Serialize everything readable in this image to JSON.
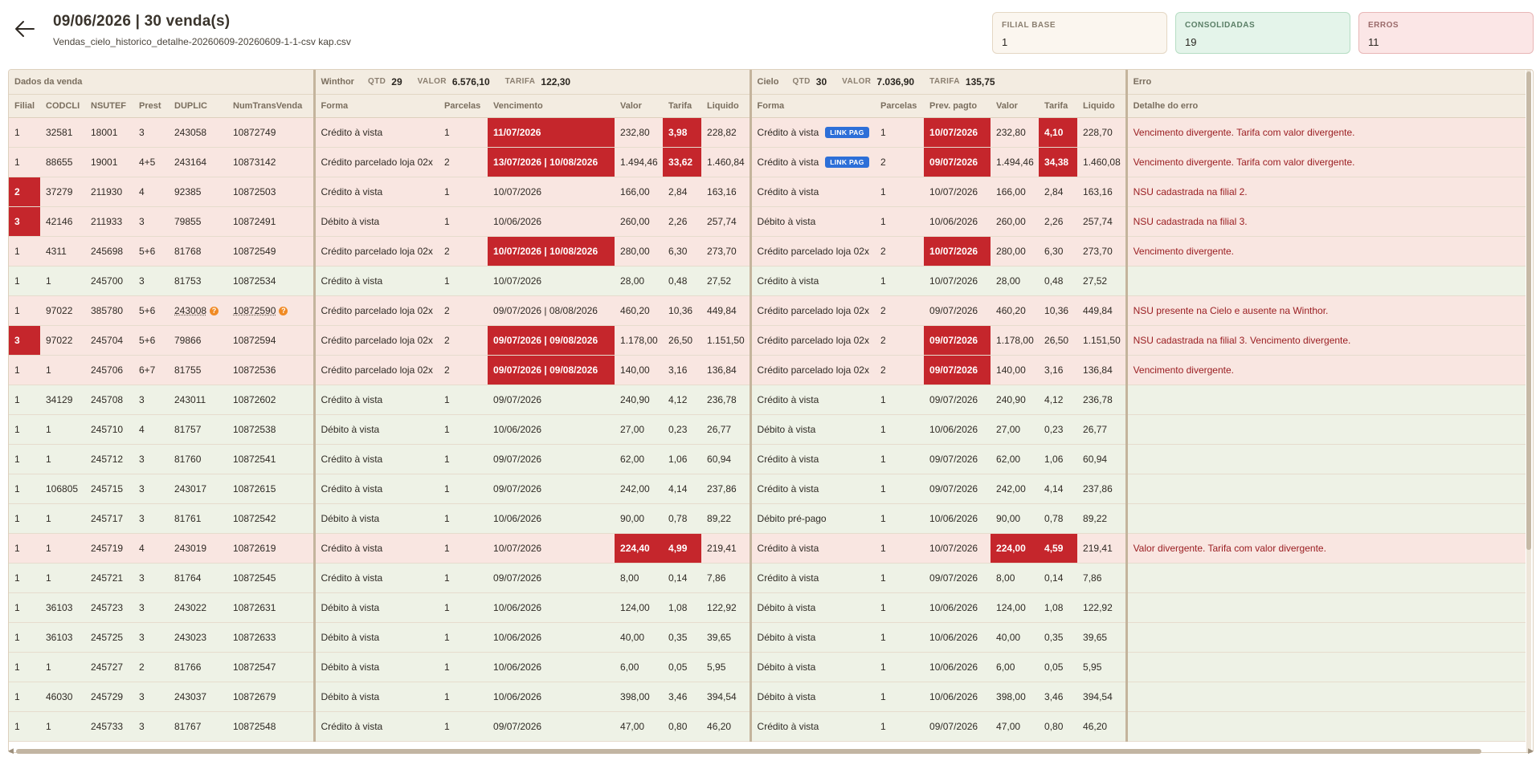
{
  "header": {
    "title": "09/06/2026 | 30 venda(s)",
    "filename": "Vendas_cielo_historico_detalhe-20260609-20260609-1-1-csv kap.csv"
  },
  "stats": {
    "base": {
      "label": "FILIAL BASE",
      "value": "1"
    },
    "consolidadas": {
      "label": "CONSOLIDADAS",
      "value": "19"
    },
    "erros": {
      "label": "ERROS",
      "value": "11"
    }
  },
  "groups": {
    "dados": {
      "name": "Dados da venda"
    },
    "winthor": {
      "name": "Winthor",
      "qtd_label": "QTD",
      "qtd": "29",
      "valor_label": "VALOR",
      "valor": "6.576,10",
      "tarifa_label": "TARIFA",
      "tarifa": "122,30"
    },
    "cielo": {
      "name": "Cielo",
      "qtd_label": "QTD",
      "qtd": "30",
      "valor_label": "VALOR",
      "valor": "7.036,90",
      "tarifa_label": "TARIFA",
      "tarifa": "135,75"
    },
    "erro": {
      "name": "Erro"
    }
  },
  "columns": [
    "Filial",
    "CODCLI",
    "NSUTEF",
    "Prest",
    "DUPLIC",
    "NumTransVenda",
    "Forma",
    "Parcelas",
    "Vencimento",
    "Valor",
    "Tarifa",
    "Liquido",
    "Forma",
    "Parcelas",
    "Prev. pagto",
    "Valor",
    "Tarifa",
    "Liquido",
    "Detalhe do erro"
  ],
  "badge_label": "LINK PAG",
  "help_icon": "question-mark-icon",
  "colors": {
    "error_red": "#c5262c",
    "ok_row": "#eef2e6",
    "bad_row": "#f9e6e1",
    "badge_blue": "#2d6fd8",
    "help_orange": "#f08a24"
  },
  "rows": [
    {
      "status": "bad",
      "filial": "1",
      "codcli": "32581",
      "nsutef": "18001",
      "prest": "3",
      "duplic": "243058",
      "numtrans": "10872749",
      "w_forma": "Crédito à vista",
      "w_parc": "1",
      "w_venc": "11/07/2026",
      "w_valor": "232,80",
      "w_tarifa": "3,98",
      "w_liq": "228,82",
      "c_forma": "Crédito à vista",
      "c_link": true,
      "c_parc": "1",
      "c_prev": "10/07/2026",
      "c_valor": "232,80",
      "c_tarifa": "4,10",
      "c_liq": "228,70",
      "erro": "Vencimento divergente. Tarifa com valor divergente.",
      "hl": [
        "w_venc",
        "w_tarifa",
        "c_prev",
        "c_tarifa"
      ]
    },
    {
      "status": "bad",
      "filial": "1",
      "codcli": "88655",
      "nsutef": "19001",
      "prest": "4+5",
      "duplic": "243164",
      "numtrans": "10873142",
      "w_forma": "Crédito parcelado loja 02x",
      "w_parc": "2",
      "w_venc": "13/07/2026 | 10/08/2026",
      "w_valor": "1.494,46",
      "w_tarifa": "33,62",
      "w_liq": "1.460,84",
      "c_forma": "Crédito à vista",
      "c_link": true,
      "c_parc": "2",
      "c_prev": "09/07/2026",
      "c_valor": "1.494,46",
      "c_tarifa": "34,38",
      "c_liq": "1.460,08",
      "erro": "Vencimento divergente. Tarifa com valor divergente.",
      "hl": [
        "w_venc",
        "w_tarifa",
        "c_prev",
        "c_tarifa"
      ]
    },
    {
      "status": "bad",
      "filial": "2",
      "codcli": "37279",
      "nsutef": "211930",
      "prest": "4",
      "duplic": "92385",
      "numtrans": "10872503",
      "w_forma": "Crédito à vista",
      "w_parc": "1",
      "w_venc": "10/07/2026",
      "w_valor": "166,00",
      "w_tarifa": "2,84",
      "w_liq": "163,16",
      "c_forma": "Crédito à vista",
      "c_parc": "1",
      "c_prev": "10/07/2026",
      "c_valor": "166,00",
      "c_tarifa": "2,84",
      "c_liq": "163,16",
      "erro": "NSU cadastrada na filial 2.",
      "hl": [
        "filial"
      ]
    },
    {
      "status": "bad",
      "filial": "3",
      "codcli": "42146",
      "nsutef": "211933",
      "prest": "3",
      "duplic": "79855",
      "numtrans": "10872491",
      "w_forma": "Débito à vista",
      "w_parc": "1",
      "w_venc": "10/06/2026",
      "w_valor": "260,00",
      "w_tarifa": "2,26",
      "w_liq": "257,74",
      "c_forma": "Débito à vista",
      "c_parc": "1",
      "c_prev": "10/06/2026",
      "c_valor": "260,00",
      "c_tarifa": "2,26",
      "c_liq": "257,74",
      "erro": "NSU cadastrada na filial 3.",
      "hl": [
        "filial"
      ]
    },
    {
      "status": "bad",
      "filial": "1",
      "codcli": "4311",
      "nsutef": "245698",
      "prest": "5+6",
      "duplic": "81768",
      "numtrans": "10872549",
      "w_forma": "Crédito parcelado loja 02x",
      "w_parc": "2",
      "w_venc": "10/07/2026 | 10/08/2026",
      "w_valor": "280,00",
      "w_tarifa": "6,30",
      "w_liq": "273,70",
      "c_forma": "Crédito parcelado loja 02x",
      "c_parc": "2",
      "c_prev": "10/07/2026",
      "c_valor": "280,00",
      "c_tarifa": "6,30",
      "c_liq": "273,70",
      "erro": "Vencimento divergente.",
      "hl": [
        "w_venc",
        "c_prev"
      ]
    },
    {
      "status": "ok",
      "filial": "1",
      "codcli": "1",
      "nsutef": "245700",
      "prest": "3",
      "duplic": "81753",
      "numtrans": "10872534",
      "w_forma": "Crédito à vista",
      "w_parc": "1",
      "w_venc": "10/07/2026",
      "w_valor": "28,00",
      "w_tarifa": "0,48",
      "w_liq": "27,52",
      "c_forma": "Crédito à vista",
      "c_parc": "1",
      "c_prev": "10/07/2026",
      "c_valor": "28,00",
      "c_tarifa": "0,48",
      "c_liq": "27,52",
      "erro": "",
      "hl": []
    },
    {
      "status": "bad",
      "filial": "1",
      "codcli": "97022",
      "nsutef": "385780",
      "prest": "5+6",
      "duplic": "243008",
      "numtrans": "10872590",
      "dup_help": true,
      "w_forma": "Crédito parcelado loja 02x",
      "w_parc": "2",
      "w_venc": "09/07/2026 | 08/08/2026",
      "w_valor": "460,20",
      "w_tarifa": "10,36",
      "w_liq": "449,84",
      "c_forma": "Crédito parcelado loja 02x",
      "c_parc": "2",
      "c_prev": "09/07/2026",
      "c_valor": "460,20",
      "c_tarifa": "10,36",
      "c_liq": "449,84",
      "erro": "NSU presente na Cielo e ausente na Winthor.",
      "hl": []
    },
    {
      "status": "bad",
      "filial": "3",
      "codcli": "97022",
      "nsutef": "245704",
      "prest": "5+6",
      "duplic": "79866",
      "numtrans": "10872594",
      "w_forma": "Crédito parcelado loja 02x",
      "w_parc": "2",
      "w_venc": "09/07/2026 | 09/08/2026",
      "w_valor": "1.178,00",
      "w_tarifa": "26,50",
      "w_liq": "1.151,50",
      "c_forma": "Crédito parcelado loja 02x",
      "c_parc": "2",
      "c_prev": "09/07/2026",
      "c_valor": "1.178,00",
      "c_tarifa": "26,50",
      "c_liq": "1.151,50",
      "erro": "NSU cadastrada na filial 3. Vencimento divergente.",
      "hl": [
        "filial",
        "w_venc",
        "c_prev"
      ]
    },
    {
      "status": "bad",
      "filial": "1",
      "codcli": "1",
      "nsutef": "245706",
      "prest": "6+7",
      "duplic": "81755",
      "numtrans": "10872536",
      "w_forma": "Crédito parcelado loja 02x",
      "w_parc": "2",
      "w_venc": "09/07/2026 | 09/08/2026",
      "w_valor": "140,00",
      "w_tarifa": "3,16",
      "w_liq": "136,84",
      "c_forma": "Crédito parcelado loja 02x",
      "c_parc": "2",
      "c_prev": "09/07/2026",
      "c_valor": "140,00",
      "c_tarifa": "3,16",
      "c_liq": "136,84",
      "erro": "Vencimento divergente.",
      "hl": [
        "w_venc",
        "c_prev"
      ]
    },
    {
      "status": "ok",
      "filial": "1",
      "codcli": "34129",
      "nsutef": "245708",
      "prest": "3",
      "duplic": "243011",
      "numtrans": "10872602",
      "w_forma": "Crédito à vista",
      "w_parc": "1",
      "w_venc": "09/07/2026",
      "w_valor": "240,90",
      "w_tarifa": "4,12",
      "w_liq": "236,78",
      "c_forma": "Crédito à vista",
      "c_parc": "1",
      "c_prev": "09/07/2026",
      "c_valor": "240,90",
      "c_tarifa": "4,12",
      "c_liq": "236,78",
      "erro": "",
      "hl": []
    },
    {
      "status": "ok",
      "filial": "1",
      "codcli": "1",
      "nsutef": "245710",
      "prest": "4",
      "duplic": "81757",
      "numtrans": "10872538",
      "w_forma": "Débito à vista",
      "w_parc": "1",
      "w_venc": "10/06/2026",
      "w_valor": "27,00",
      "w_tarifa": "0,23",
      "w_liq": "26,77",
      "c_forma": "Débito à vista",
      "c_parc": "1",
      "c_prev": "10/06/2026",
      "c_valor": "27,00",
      "c_tarifa": "0,23",
      "c_liq": "26,77",
      "erro": "",
      "hl": []
    },
    {
      "status": "ok",
      "filial": "1",
      "codcli": "1",
      "nsutef": "245712",
      "prest": "3",
      "duplic": "81760",
      "numtrans": "10872541",
      "w_forma": "Crédito à vista",
      "w_parc": "1",
      "w_venc": "09/07/2026",
      "w_valor": "62,00",
      "w_tarifa": "1,06",
      "w_liq": "60,94",
      "c_forma": "Crédito à vista",
      "c_parc": "1",
      "c_prev": "09/07/2026",
      "c_valor": "62,00",
      "c_tarifa": "1,06",
      "c_liq": "60,94",
      "erro": "",
      "hl": []
    },
    {
      "status": "ok",
      "filial": "1",
      "codcli": "106805",
      "nsutef": "245715",
      "prest": "3",
      "duplic": "243017",
      "numtrans": "10872615",
      "w_forma": "Crédito à vista",
      "w_parc": "1",
      "w_venc": "09/07/2026",
      "w_valor": "242,00",
      "w_tarifa": "4,14",
      "w_liq": "237,86",
      "c_forma": "Crédito à vista",
      "c_parc": "1",
      "c_prev": "09/07/2026",
      "c_valor": "242,00",
      "c_tarifa": "4,14",
      "c_liq": "237,86",
      "erro": "",
      "hl": []
    },
    {
      "status": "ok",
      "filial": "1",
      "codcli": "1",
      "nsutef": "245717",
      "prest": "3",
      "duplic": "81761",
      "numtrans": "10872542",
      "w_forma": "Débito à vista",
      "w_parc": "1",
      "w_venc": "10/06/2026",
      "w_valor": "90,00",
      "w_tarifa": "0,78",
      "w_liq": "89,22",
      "c_forma": "Débito pré-pago",
      "c_parc": "1",
      "c_prev": "10/06/2026",
      "c_valor": "90,00",
      "c_tarifa": "0,78",
      "c_liq": "89,22",
      "erro": "",
      "hl": []
    },
    {
      "status": "bad",
      "filial": "1",
      "codcli": "1",
      "nsutef": "245719",
      "prest": "4",
      "duplic": "243019",
      "numtrans": "10872619",
      "w_forma": "Crédito à vista",
      "w_parc": "1",
      "w_venc": "10/07/2026",
      "w_valor": "224,40",
      "w_tarifa": "4,99",
      "w_liq": "219,41",
      "c_forma": "Crédito à vista",
      "c_parc": "1",
      "c_prev": "10/07/2026",
      "c_valor": "224,00",
      "c_tarifa": "4,59",
      "c_liq": "219,41",
      "erro": "Valor divergente. Tarifa com valor divergente.",
      "hl": [
        "w_valor",
        "w_tarifa",
        "c_valor",
        "c_tarifa"
      ]
    },
    {
      "status": "ok",
      "filial": "1",
      "codcli": "1",
      "nsutef": "245721",
      "prest": "3",
      "duplic": "81764",
      "numtrans": "10872545",
      "w_forma": "Crédito à vista",
      "w_parc": "1",
      "w_venc": "09/07/2026",
      "w_valor": "8,00",
      "w_tarifa": "0,14",
      "w_liq": "7,86",
      "c_forma": "Crédito à vista",
      "c_parc": "1",
      "c_prev": "09/07/2026",
      "c_valor": "8,00",
      "c_tarifa": "0,14",
      "c_liq": "7,86",
      "erro": "",
      "hl": []
    },
    {
      "status": "ok",
      "filial": "1",
      "codcli": "36103",
      "nsutef": "245723",
      "prest": "3",
      "duplic": "243022",
      "numtrans": "10872631",
      "w_forma": "Débito à vista",
      "w_parc": "1",
      "w_venc": "10/06/2026",
      "w_valor": "124,00",
      "w_tarifa": "1,08",
      "w_liq": "122,92",
      "c_forma": "Débito à vista",
      "c_parc": "1",
      "c_prev": "10/06/2026",
      "c_valor": "124,00",
      "c_tarifa": "1,08",
      "c_liq": "122,92",
      "erro": "",
      "hl": []
    },
    {
      "status": "ok",
      "filial": "1",
      "codcli": "36103",
      "nsutef": "245725",
      "prest": "3",
      "duplic": "243023",
      "numtrans": "10872633",
      "w_forma": "Débito à vista",
      "w_parc": "1",
      "w_venc": "10/06/2026",
      "w_valor": "40,00",
      "w_tarifa": "0,35",
      "w_liq": "39,65",
      "c_forma": "Débito à vista",
      "c_parc": "1",
      "c_prev": "10/06/2026",
      "c_valor": "40,00",
      "c_tarifa": "0,35",
      "c_liq": "39,65",
      "erro": "",
      "hl": []
    },
    {
      "status": "ok",
      "filial": "1",
      "codcli": "1",
      "nsutef": "245727",
      "prest": "2",
      "duplic": "81766",
      "numtrans": "10872547",
      "w_forma": "Débito à vista",
      "w_parc": "1",
      "w_venc": "10/06/2026",
      "w_valor": "6,00",
      "w_tarifa": "0,05",
      "w_liq": "5,95",
      "c_forma": "Débito à vista",
      "c_parc": "1",
      "c_prev": "10/06/2026",
      "c_valor": "6,00",
      "c_tarifa": "0,05",
      "c_liq": "5,95",
      "erro": "",
      "hl": []
    },
    {
      "status": "ok",
      "filial": "1",
      "codcli": "46030",
      "nsutef": "245729",
      "prest": "3",
      "duplic": "243037",
      "numtrans": "10872679",
      "w_forma": "Débito à vista",
      "w_parc": "1",
      "w_venc": "10/06/2026",
      "w_valor": "398,00",
      "w_tarifa": "3,46",
      "w_liq": "394,54",
      "c_forma": "Débito à vista",
      "c_parc": "1",
      "c_prev": "10/06/2026",
      "c_valor": "398,00",
      "c_tarifa": "3,46",
      "c_liq": "394,54",
      "erro": "",
      "hl": []
    },
    {
      "status": "ok",
      "filial": "1",
      "codcli": "1",
      "nsutef": "245733",
      "prest": "3",
      "duplic": "81767",
      "numtrans": "10872548",
      "w_forma": "Crédito à vista",
      "w_parc": "1",
      "w_venc": "09/07/2026",
      "w_valor": "47,00",
      "w_tarifa": "0,80",
      "w_liq": "46,20",
      "c_forma": "Crédito à vista",
      "c_parc": "1",
      "c_prev": "09/07/2026",
      "c_valor": "47,00",
      "c_tarifa": "0,80",
      "c_liq": "46,20",
      "erro": "",
      "hl": []
    }
  ]
}
